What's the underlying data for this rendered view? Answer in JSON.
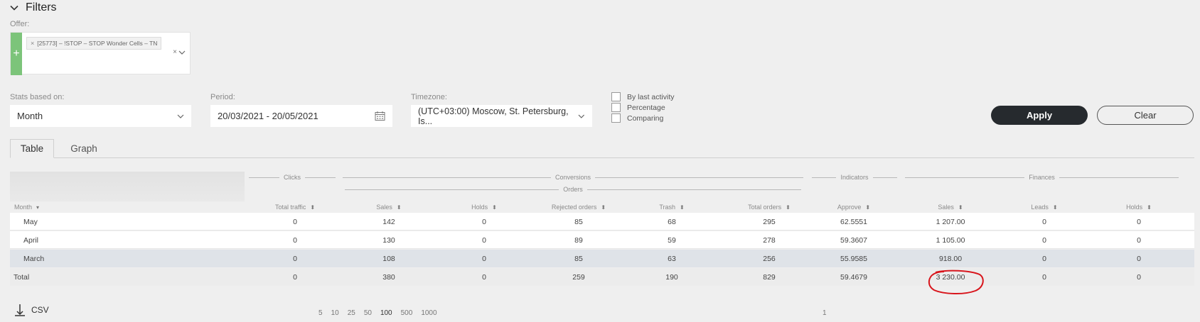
{
  "filters": {
    "title": "Filters"
  },
  "offer": {
    "label": "Offer:",
    "tag": "[25773] – !STOP – STOP Wonder Cells – TN",
    "tag_remove": "×",
    "clear_symbol": "×"
  },
  "stats": {
    "label": "Stats based on:",
    "value": "Month"
  },
  "period": {
    "label": "Period:",
    "value": "20/03/2021 - 20/05/2021"
  },
  "timezone": {
    "label": "Timezone:",
    "value": "(UTC+03:00) Moscow, St. Petersburg, Is..."
  },
  "checkboxes": [
    "By last activity",
    "Percentage",
    "Comparing"
  ],
  "buttons": {
    "apply": "Apply",
    "clear": "Clear"
  },
  "tabs": [
    "Table",
    "Graph"
  ],
  "groups": {
    "clicks": "Clicks",
    "conversions": "Conversions",
    "orders": "Orders",
    "indicators": "Indicators",
    "finances": "Finances"
  },
  "columns": [
    "Month",
    "Total traffic",
    "Sales",
    "Holds",
    "Rejected orders",
    "Trash",
    "Total orders",
    "Approve",
    "Sales",
    "Leads",
    "Holds"
  ],
  "rows": [
    {
      "month": "May",
      "cells": [
        "0",
        "142",
        "0",
        "85",
        "68",
        "295",
        "62.5551",
        "1 207.00",
        "0",
        "0"
      ]
    },
    {
      "month": "April",
      "cells": [
        "0",
        "130",
        "0",
        "89",
        "59",
        "278",
        "59.3607",
        "1 105.00",
        "0",
        "0"
      ]
    },
    {
      "month": "March",
      "cells": [
        "0",
        "108",
        "0",
        "85",
        "63",
        "256",
        "55.9585",
        "918.00",
        "0",
        "0"
      ]
    }
  ],
  "total": {
    "label": "Total",
    "cells": [
      "0",
      "380",
      "0",
      "259",
      "190",
      "829",
      "59.4679",
      "3 230.00",
      "0",
      "0"
    ]
  },
  "footer": {
    "csv": "CSV",
    "page_sizes": [
      "5",
      "10",
      "25",
      "50",
      "100",
      "500",
      "1000"
    ],
    "page": "1"
  },
  "colors": {
    "accent_green": "#7cc47a",
    "apply_bg": "#262a2e",
    "annotation_red": "#d8151c"
  }
}
